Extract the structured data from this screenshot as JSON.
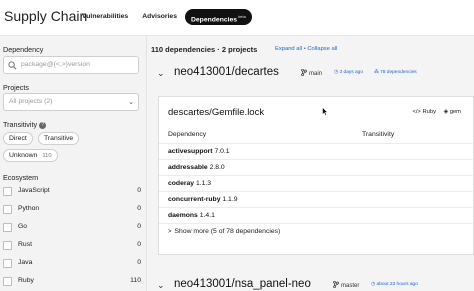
{
  "header": {
    "title": "Supply Chain",
    "tabs": [
      {
        "label": "Vulnerabilities"
      },
      {
        "label": "Advisories"
      },
      {
        "label": "Dependencies",
        "badge": "beta"
      }
    ]
  },
  "sidebar": {
    "dependency_label": "Dependency",
    "dependency_placeholder": "package@{<,>}version",
    "projects_label": "Projects",
    "projects_selected": "All projects (2)",
    "transitivity_label": "Transitivity",
    "transitivity_options": [
      {
        "label": "Direct"
      },
      {
        "label": "Transitive"
      },
      {
        "label": "Unknown",
        "count": "110"
      }
    ],
    "ecosystem_label": "Ecosystem",
    "ecosystems": [
      {
        "name": "JavaScript",
        "count": "0"
      },
      {
        "name": "Python",
        "count": "0"
      },
      {
        "name": "Go",
        "count": "0"
      },
      {
        "name": "Rust",
        "count": "0"
      },
      {
        "name": "Java",
        "count": "0"
      },
      {
        "name": "Ruby",
        "count": "110"
      }
    ]
  },
  "main": {
    "summary": "110 dependencies · 2 projects",
    "expand_all": "Expand all",
    "separator": "•",
    "collapse_all": "Collapse all",
    "projects": [
      {
        "name": "neo413001/decartes",
        "branch": "main",
        "updated": "3 days ago",
        "deps_count": "78 dependencies",
        "lockfile": {
          "title": "descartes/Gemfile.lock",
          "language": "Ruby",
          "package_manager": "gem",
          "col_dependency": "Dependency",
          "col_transitivity": "Transitivity",
          "rows": [
            {
              "name": "activesupport",
              "version": "7.0.1"
            },
            {
              "name": "addressable",
              "version": "2.8.0"
            },
            {
              "name": "coderay",
              "version": "1.1.3"
            },
            {
              "name": "concurrent-ruby",
              "version": "1.1.9"
            },
            {
              "name": "daemons",
              "version": "1.4.1"
            }
          ],
          "show_more": "Show more (5 of 78 dependencies)"
        }
      },
      {
        "name": "neo413001/nsa_panel-neo",
        "branch": "master",
        "updated": "about 23 hours ago"
      }
    ]
  },
  "colors": {
    "accent": "#1a66d6",
    "active_tab_bg": "#111111",
    "sidebar_bg": "#f3f3f3"
  }
}
